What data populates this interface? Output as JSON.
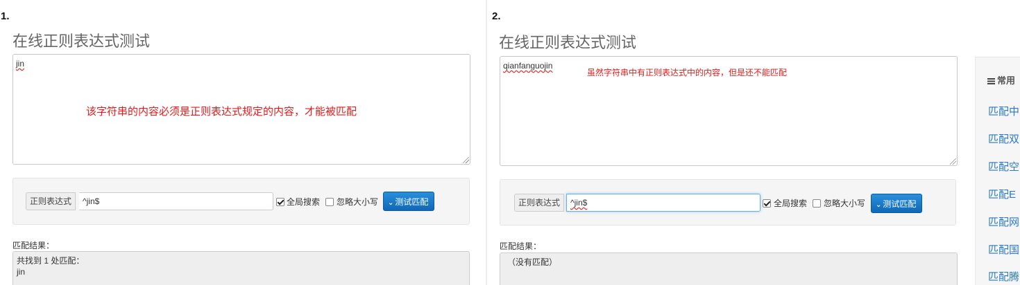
{
  "panels": [
    {
      "step": "1.",
      "title": "在线正则表达式测试",
      "input_text": "jin",
      "annotation": "该字符串的内容必须是正则表达式规定的内容，才能被匹配",
      "regex_label": "正则表达式",
      "regex_value": "^jin$",
      "global_search_label": "全局搜索",
      "global_search_checked": true,
      "ignore_case_label": "忽略大小写",
      "ignore_case_checked": false,
      "test_button_label": "测试匹配",
      "result_label": "匹配结果：",
      "result_lines": [
        "共找到 1 处匹配：",
        "jin"
      ]
    },
    {
      "step": "2.",
      "title": "在线正则表达式测试",
      "input_text": "qianfanguojin",
      "annotation": "虽然字符串中有正则表达式中的内容，但是还不能匹配",
      "regex_label": "正则表达式",
      "regex_value": "^jin$",
      "global_search_label": "全局搜索",
      "global_search_checked": true,
      "ignore_case_label": "忽略大小写",
      "ignore_case_checked": false,
      "test_button_label": "测试匹配",
      "result_label": "匹配结果：",
      "result_lines": [
        "（没有匹配）"
      ]
    }
  ],
  "sidebar": {
    "header": "常用",
    "links": [
      "匹配中",
      "匹配双",
      "匹配空",
      "匹配E",
      "匹配网",
      "匹配国",
      "匹配腾"
    ]
  },
  "colors": {
    "annotation": "#e31b1b",
    "button": "#1a7bcf",
    "link": "#2a7ac8"
  }
}
